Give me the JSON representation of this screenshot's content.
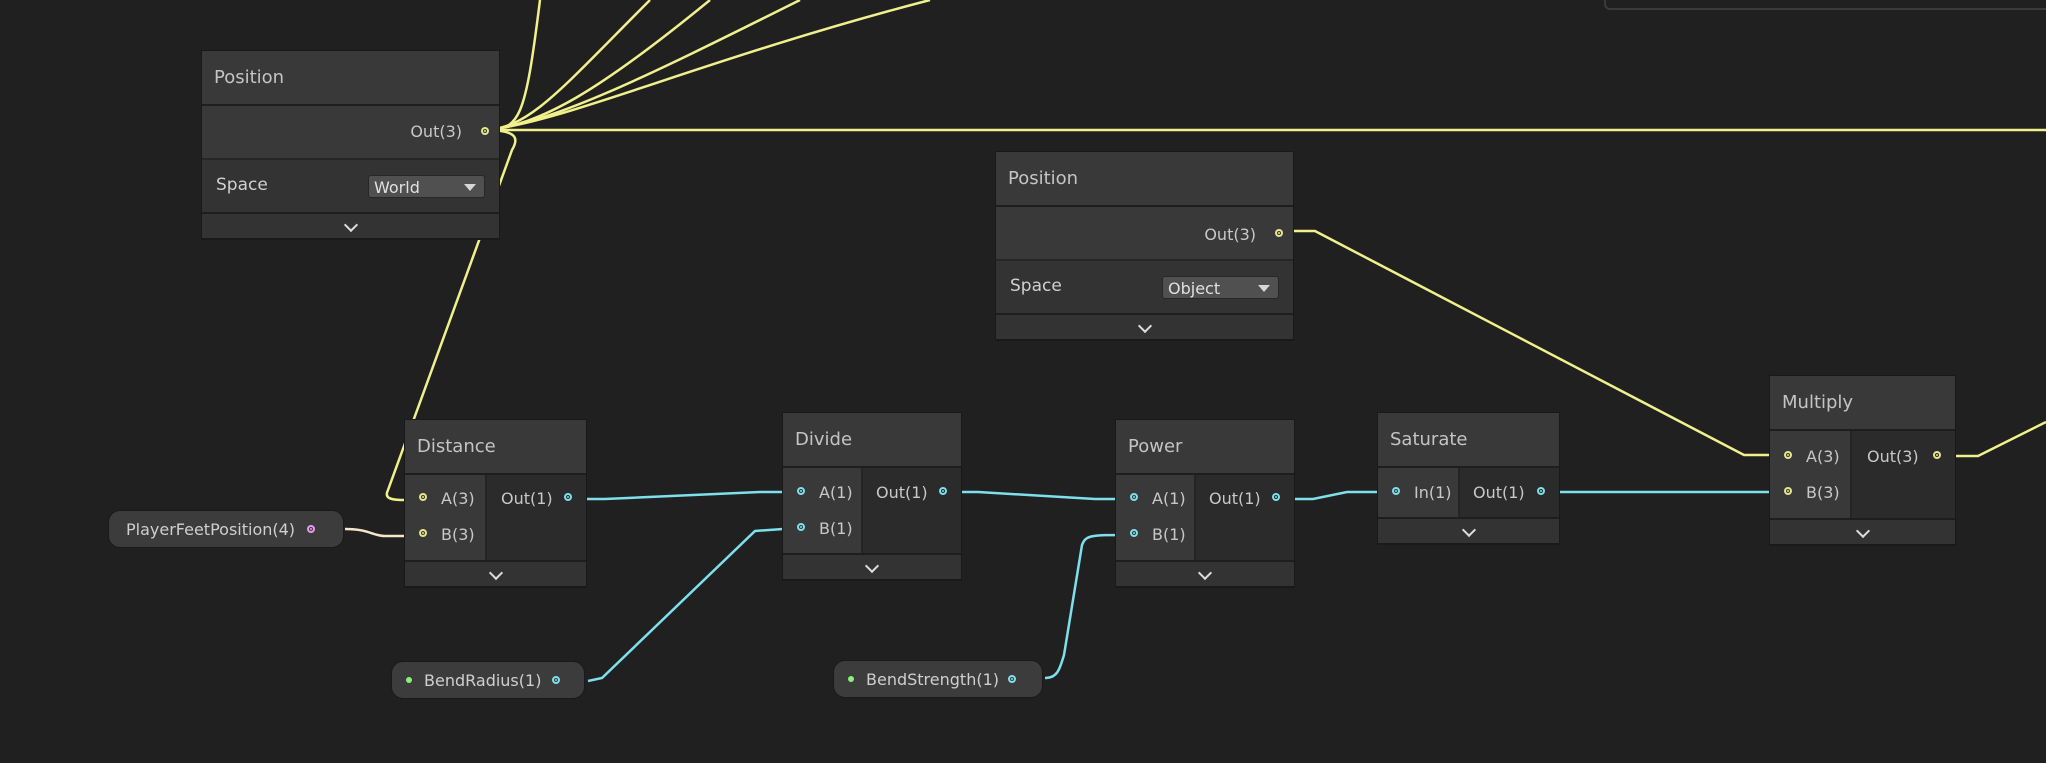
{
  "nodes": {
    "position_world": {
      "title": "Position",
      "out_label": "Out(3)",
      "space_label": "Space",
      "space_value": "World"
    },
    "position_object": {
      "title": "Position",
      "out_label": "Out(3)",
      "space_label": "Space",
      "space_value": "Object"
    },
    "distance": {
      "title": "Distance",
      "in_a": "A(3)",
      "in_b": "B(3)",
      "out_label": "Out(1)"
    },
    "divide": {
      "title": "Divide",
      "in_a": "A(1)",
      "in_b": "B(1)",
      "out_label": "Out(1)"
    },
    "power": {
      "title": "Power",
      "in_a": "A(1)",
      "in_b": "B(1)",
      "out_label": "Out(1)"
    },
    "saturate": {
      "title": "Saturate",
      "in_label": "In(1)",
      "out_label": "Out(1)"
    },
    "multiply": {
      "title": "Multiply",
      "in_a": "A(3)",
      "in_b": "B(3)",
      "out_label": "Out(3)"
    }
  },
  "properties": {
    "player_feet": {
      "label": "PlayerFeetPosition(4)"
    },
    "bend_radius": {
      "label": "BendRadius(1)"
    },
    "bend_strength": {
      "label": "BendStrength(1)"
    }
  },
  "colors": {
    "vector3_wire": "#f0f08c",
    "float_wire": "#7de0ec",
    "vector4_wire": "#f5e6c8",
    "background": "#202020"
  }
}
